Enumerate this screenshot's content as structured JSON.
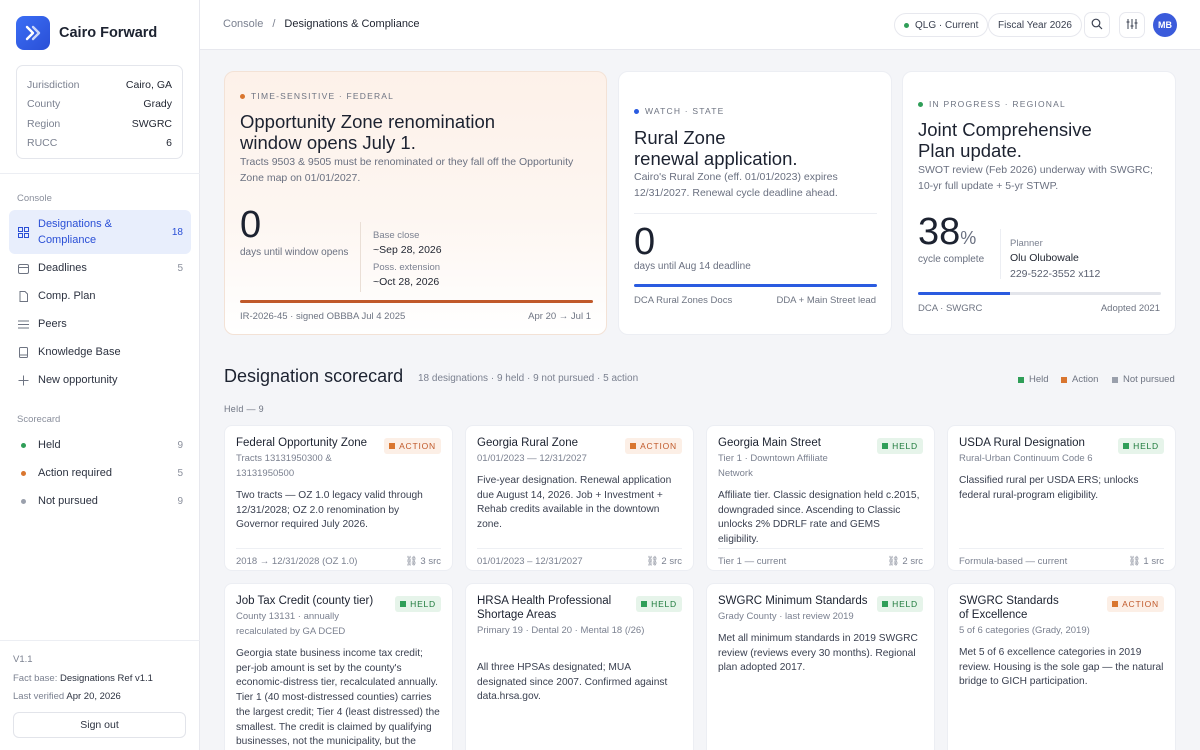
{
  "brand": {
    "name": "Cairo Forward"
  },
  "jurisdiction": [
    {
      "key": "Jurisdiction",
      "value": "Cairo, GA"
    },
    {
      "key": "County",
      "value": "Grady"
    },
    {
      "key": "Region",
      "value": "SWGRC"
    },
    {
      "key": "RUCC",
      "value": "6"
    }
  ],
  "sidebar": {
    "console_label": "Console",
    "nav": [
      {
        "label": "Designations & Compliance",
        "count": "18",
        "icon": "grid-icon"
      },
      {
        "label": "Deadlines",
        "count": "5",
        "icon": "calendar-icon"
      },
      {
        "label": "Comp. Plan",
        "count": "",
        "icon": "document-icon"
      },
      {
        "label": "Peers",
        "count": "",
        "icon": "list-icon"
      },
      {
        "label": "Knowledge Base",
        "count": "",
        "icon": "book-icon"
      },
      {
        "label": "New opportunity",
        "count": "",
        "icon": "plus-icon"
      }
    ],
    "scorecard_label": "Scorecard",
    "scorecard": [
      {
        "label": "Held",
        "count": "9",
        "color": "#2f9e58"
      },
      {
        "label": "Action required",
        "count": "5",
        "color": "#d9762f"
      },
      {
        "label": "Not pursued",
        "count": "9",
        "color": "#9aa0ac"
      }
    ],
    "version": "V1.1",
    "fact_base_label": "Fact base:",
    "fact_base_value": "Designations Ref v1.1",
    "verified_label": "Last verified",
    "verified_value": "Apr 20, 2026",
    "sign_out": "Sign out"
  },
  "topbar": {
    "crumb_root": "Console",
    "crumb_sep": "/",
    "crumb_current": "Designations & Compliance",
    "qlg": "QLG · Current",
    "fiscal": "Fiscal Year 2026",
    "avatar": "MB"
  },
  "hero": {
    "federal": {
      "eyebrow": "Time-sensitive · Federal",
      "title_line1": "Opportunity Zone renomination",
      "title_line2": "window opens July 1.",
      "desc": "Tracts 9503 & 9505 must be renominated or they fall off the Opportunity Zone map on 01/01/2027.",
      "big": "0",
      "big_sub": "days until window opens",
      "base_label": "Base close",
      "base_value": "~Sep 28, 2026",
      "ext_label": "Poss. extension",
      "ext_value": "~Oct 28, 2026",
      "progress": 1.0,
      "foot_left": "IR-2026-45 · signed OBBBA Jul 4 2025",
      "foot_right": "Apr 20 → Jul 1"
    },
    "state": {
      "eyebrow": "Watch · State",
      "title_line1": "Rural Zone",
      "title_line2": "renewal application.",
      "desc": "Cairo's Rural Zone (eff. 01/01/2023) expires 12/31/2027. Renewal cycle deadline ahead.",
      "big": "0",
      "big_sub": "days until Aug 14 deadline",
      "progress": 1.0,
      "foot_left": "DCA Rural Zones Docs",
      "foot_right": "DDA + Main Street lead"
    },
    "regional": {
      "eyebrow": "In progress · Regional",
      "title_line1": "Joint Comprehensive",
      "title_line2": "Plan update.",
      "desc": "SWOT review (Feb 2026) underway with SWGRC; 10-yr full update + 5-yr STWP.",
      "big": "38",
      "big_unit": "%",
      "big_sub": "cycle complete",
      "planner_label": "Planner",
      "planner_name": "Olu Olubowale",
      "planner_phone": "229-522-3552 x112",
      "progress": 0.38,
      "foot_left": "DCA · SWGRC",
      "foot_right": "Adopted 2021"
    }
  },
  "scorecard": {
    "title": "Designation scorecard",
    "meta": "18 designations · 9 held · 9 not pursued · 5 action",
    "legend": [
      {
        "label": "Held",
        "color": "#2f9e58"
      },
      {
        "label": "Action",
        "color": "#d9762f"
      },
      {
        "label": "Not pursued",
        "color": "#9aa0ac"
      }
    ],
    "group_label": "Held — 9",
    "row1": [
      {
        "title": "Federal Opportunity Zone",
        "badge": "ACTION",
        "status": "action",
        "sub": "Tracts 13131950300 & 13131950500",
        "body": "Two tracts — OZ 1.0 legacy valid through 12/31/2028; OZ 2.0 renomination by Governor required July 2026.",
        "foot_left": "2018 → 12/31/2028 (OZ 1.0)",
        "foot_right": "3 src"
      },
      {
        "title": "Georgia Rural Zone",
        "badge": "ACTION",
        "status": "action",
        "sub": "01/01/2023 — 12/31/2027",
        "body": "Five-year designation. Renewal application due August 14, 2026. Job + Investment + Rehab credits available in the downtown zone.",
        "foot_left": "01/01/2023 – 12/31/2027",
        "foot_right": "2 src"
      },
      {
        "title": "Georgia Main Street",
        "badge": "HELD",
        "status": "held",
        "sub": "Tier 1 · Downtown Affiliate Network",
        "body": "Affiliate tier. Classic designation held c.2015, downgraded since. Ascending to Classic unlocks 2% DDRLF rate and GEMS eligibility.",
        "foot_left": "Tier 1 — current",
        "foot_right": "2 src"
      },
      {
        "title": "USDA Rural Designation",
        "badge": "HELD",
        "status": "held",
        "sub": "Rural-Urban Continuum Code 6",
        "body": "Classified rural per USDA ERS; unlocks federal rural-program eligibility.",
        "foot_left": "Formula-based — current",
        "foot_right": "1 src"
      }
    ],
    "row2": [
      {
        "title": "Job Tax Credit (county tier)",
        "badge": "HELD",
        "status": "held",
        "sub": "County 13131 · annually recalculated by GA DCED",
        "body": "Georgia state business income tax credit; per-job amount is set by the county's economic-distress tier, recalculated annually. Tier 1 (40 most-distressed counties) carries the largest credit; Tier 4 (least distressed) the smallest. The credit is claimed by qualifying businesses, not the municipality, but the county tier is a"
      },
      {
        "title": "HRSA Health Professional Shortage Areas",
        "badge": "HELD",
        "status": "held",
        "sub": "Primary 19 · Dental 20 · Mental 18 (/26)",
        "body": "All three HPSAs designated; MUA designated since 2007. Confirmed against data.hrsa.gov."
      },
      {
        "title": "SWGRC Minimum Standards",
        "badge": "HELD",
        "status": "held",
        "sub": "Grady County · last review 2019",
        "body": "Met all minimum standards in 2019 SWGRC review (reviews every 30 months). Regional plan adopted 2017."
      },
      {
        "title": "SWGRC Standards of Excellence",
        "badge": "ACTION",
        "status": "action",
        "sub": "5 of 6 categories (Grady, 2019)",
        "body": "Met 5 of 6 excellence categories in 2019 review. Housing is the sole gap — the natural bridge to GICH participation."
      }
    ]
  }
}
